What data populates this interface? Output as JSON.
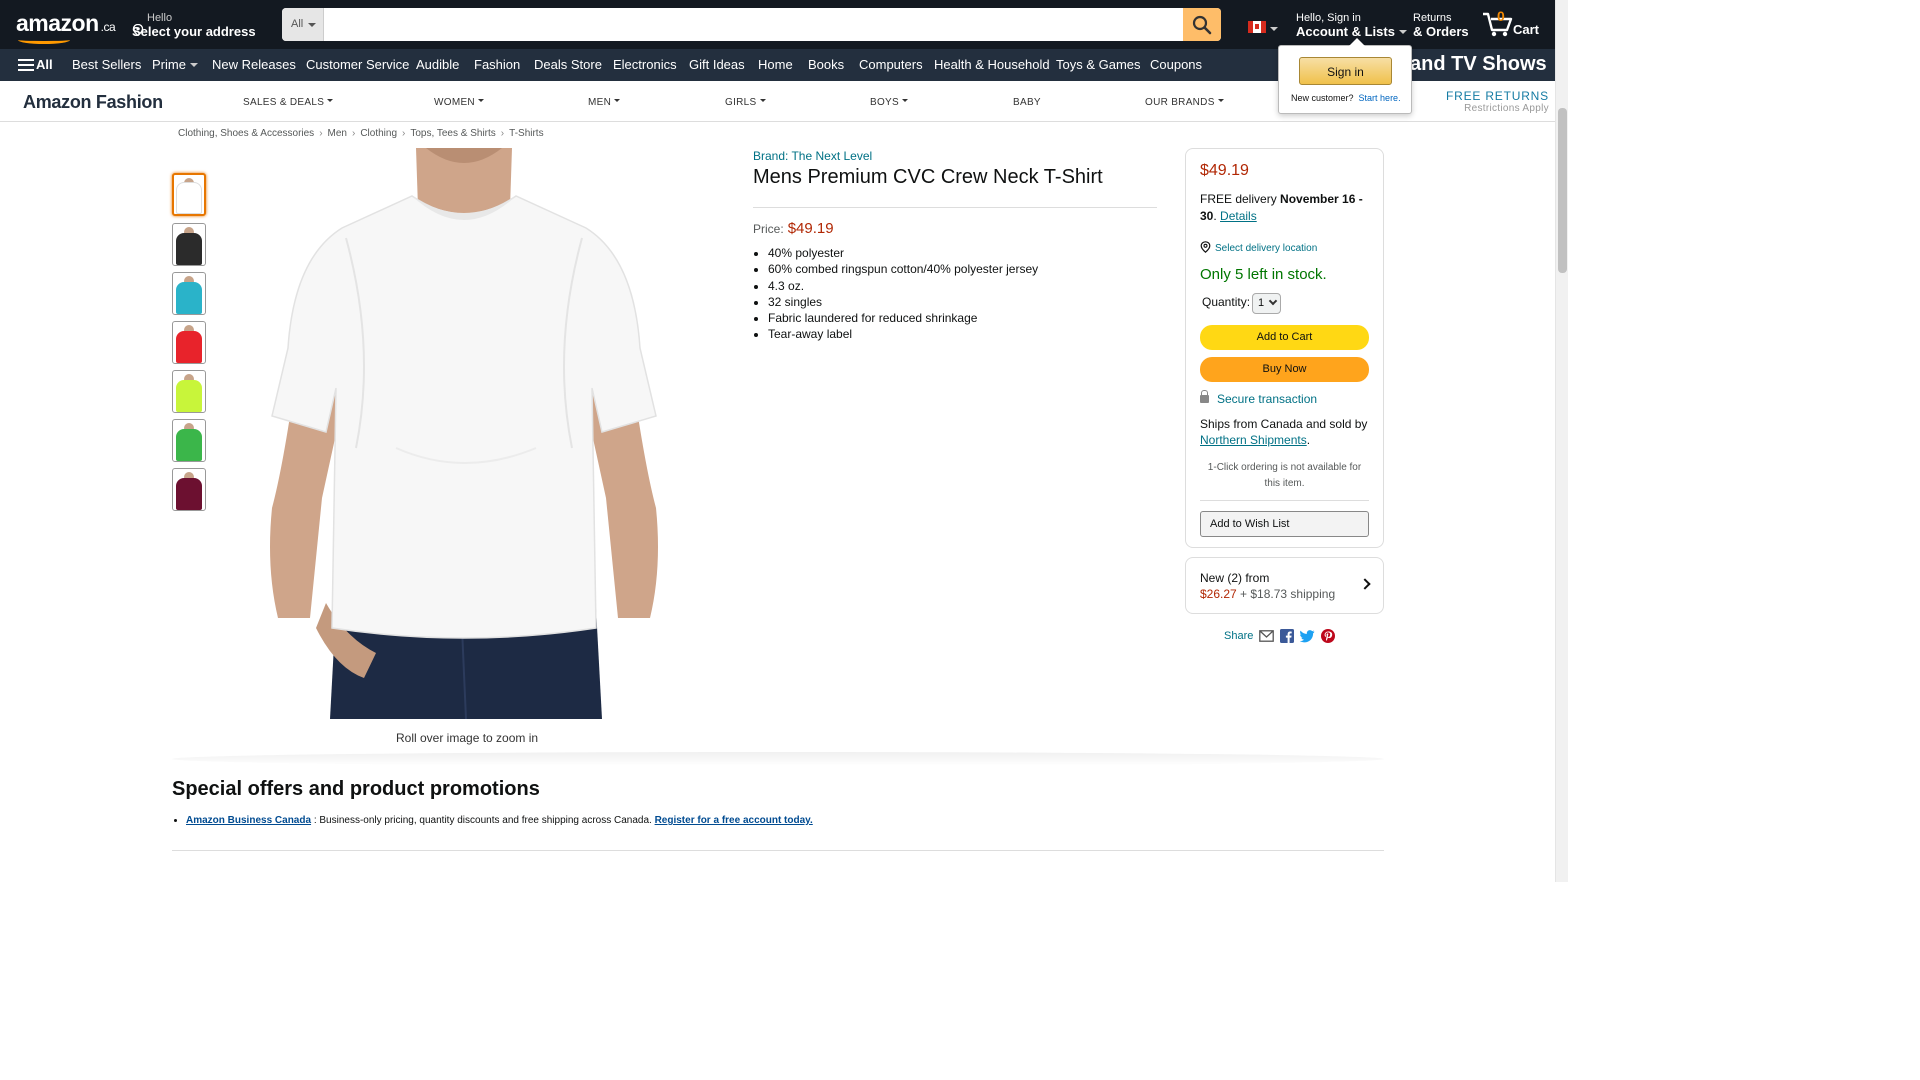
{
  "header": {
    "logo_text": "amazon",
    "logo_suffix": ".ca",
    "deliver_line1": "Hello",
    "deliver_line2": "Select your address",
    "search_category": "All",
    "search_placeholder": "",
    "account_line1": "Hello, Sign in",
    "account_line2": "Account & Lists",
    "returns_line1": "Returns",
    "returns_line2": "& Orders",
    "cart_count": "0",
    "cart_label": "Cart"
  },
  "subnav": {
    "all_label": "All",
    "items": [
      "Best Sellers",
      "Prime",
      "New Releases",
      "Customer Service",
      "Audible",
      "Fashion",
      "Deals Store",
      "Electronics",
      "Gift Ideas",
      "Home",
      "Books",
      "Computers",
      "Health & Household",
      "Toys & Games",
      "Coupons"
    ],
    "banner_text": "and TV Shows"
  },
  "signin_popover": {
    "button_label": "Sign in",
    "new_customer": "New customer?",
    "start_here": "Start here."
  },
  "fashion_bar": {
    "logo": "Amazon Fashion",
    "items": [
      "SALES & DEALS",
      "WOMEN",
      "MEN",
      "GIRLS",
      "BOYS",
      "BABY",
      "OUR BRANDS"
    ],
    "free_returns": "FREE RETURNS",
    "free_returns_sub": "Restrictions Apply"
  },
  "breadcrumb": [
    "Clothing, Shoes & Accessories",
    "Men",
    "Clothing",
    "Tops, Tees & Shirts",
    "T-Shirts"
  ],
  "thumbnails": [
    {
      "color": "#ffffff",
      "selected": true
    },
    {
      "color": "#2b2b2b",
      "selected": false
    },
    {
      "color": "#2ab3c9",
      "selected": false
    },
    {
      "color": "#e8232b",
      "selected": false
    },
    {
      "color": "#c8f53a",
      "selected": false
    },
    {
      "color": "#3bb64a",
      "selected": false
    },
    {
      "color": "#6c1030",
      "selected": false
    }
  ],
  "main_image": {
    "zoom_hint": "Roll over image to zoom in"
  },
  "product": {
    "brand": "Brand: The Next Level",
    "title": "Mens Premium CVC Crew Neck T-Shirt",
    "price_label": "Price:",
    "price": "$49.19",
    "bullets": [
      "40% polyester",
      "60% combed ringspun cotton/40% polyester jersey",
      "4.3 oz.",
      "32 singles",
      "Fabric laundered for reduced shrinkage",
      "Tear-away label"
    ]
  },
  "buybox": {
    "price": "$49.19",
    "delivery_prefix": "FREE delivery ",
    "delivery_dates": "November 16 - 30",
    "delivery_suffix": ". ",
    "details_link": "Details",
    "location_link": "Select delivery location",
    "stock": "Only 5 left in stock.",
    "quantity_label": "Quantity:",
    "quantity_value": "1",
    "add_to_cart": "Add to Cart",
    "buy_now": "Buy Now",
    "secure": "Secure transaction",
    "ships_text": "Ships from Canada and sold by ",
    "seller": "Northern Shipments",
    "ships_end": ".",
    "one_click": "1-Click ordering is not available for this item.",
    "wish_list": "Add to Wish List"
  },
  "new_offers": {
    "line1": "New (2) from",
    "price": "$26.27",
    "shipping": " + $18.73 shipping"
  },
  "share": {
    "label": "Share"
  },
  "promotions": {
    "title": "Special offers and product promotions",
    "link1": "Amazon Business Canada",
    "text": " : Business-only pricing, quantity discounts and free shipping across Canada. ",
    "link2": "Register for a free account today."
  },
  "colors": {
    "nav_dark": "#131921",
    "nav_sub": "#232f3e",
    "accent_orange": "#ff9900",
    "price_red": "#b12704",
    "link_teal": "#007185",
    "stock_green": "#007600",
    "cart_yellow": "#ffd814",
    "buy_orange": "#ffa41c"
  }
}
